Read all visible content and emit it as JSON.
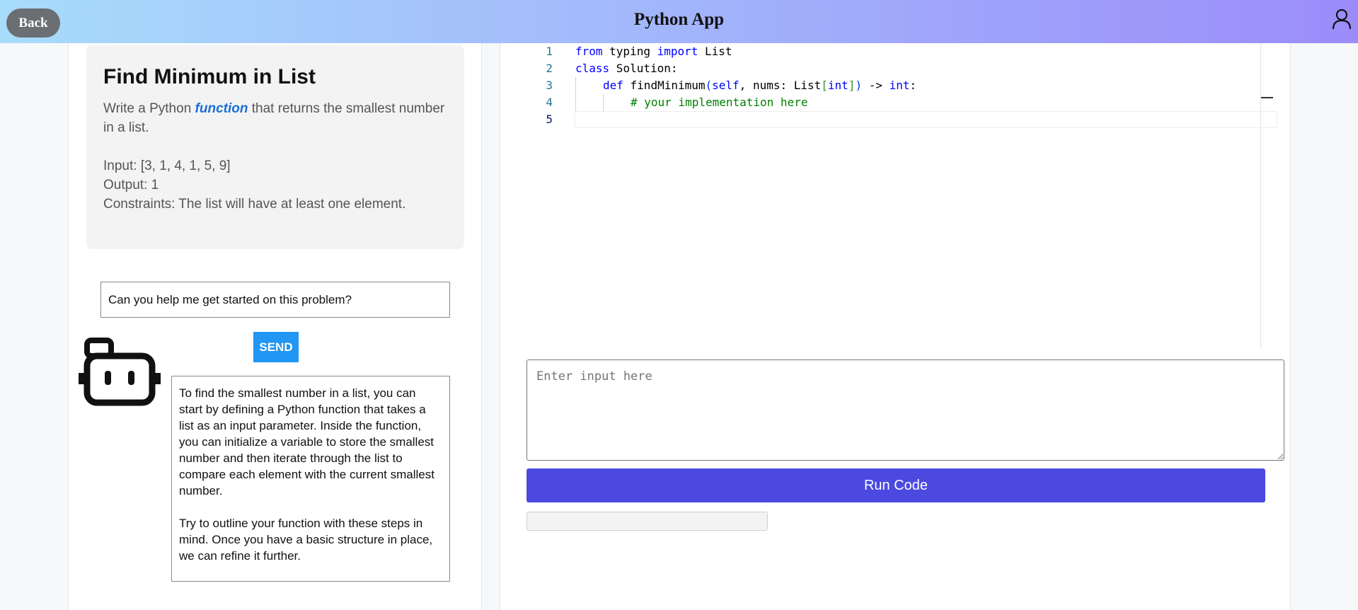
{
  "header": {
    "back_label": "Back",
    "title": "Python App"
  },
  "problem": {
    "title": "Find Minimum in List",
    "desc_before": "Write a Python ",
    "desc_emphasis": "function",
    "desc_after": " that returns the smallest number in a list.",
    "input": "Input: [3, 1, 4, 1, 5, 9]",
    "output": "Output: 1",
    "constraints": "Constraints: The list will have at least one element."
  },
  "chat": {
    "input_value": "Can you help me get started on this problem?",
    "send_label": "SEND",
    "reply_p1": "To find the smallest number in a list, you can start by defining a Python function that takes a list as an input parameter. Inside the function, you can initialize a variable to store the smallest number and then iterate through the list to compare each element with the current smallest number.",
    "reply_p2": "Try to outline your function with these steps in mind. Once you have a basic structure in place, we can refine it further."
  },
  "editor": {
    "line_numbers": [
      "1",
      "2",
      "3",
      "4",
      "5"
    ],
    "line1": {
      "kw1": "from",
      "t1": " typing ",
      "kw2": "import",
      "t2": " List"
    },
    "line2": {
      "kw1": "class",
      "t1": " Solution:"
    },
    "line3": {
      "kw1": "def",
      "t1": " findMinimum",
      "p1": "(",
      "kw2": "self",
      "t2": ", nums: List",
      "b1": "[",
      "kw3": "int",
      "b2": "]",
      "p2": ")",
      "t3": " -> ",
      "kw4": "int",
      "t4": ":"
    },
    "line4": {
      "comment": "# your implementation here"
    }
  },
  "runner": {
    "input_placeholder": "Enter input here",
    "run_label": "Run Code",
    "output_value": ""
  },
  "icons": [
    "user-icon",
    "robot-icon"
  ]
}
